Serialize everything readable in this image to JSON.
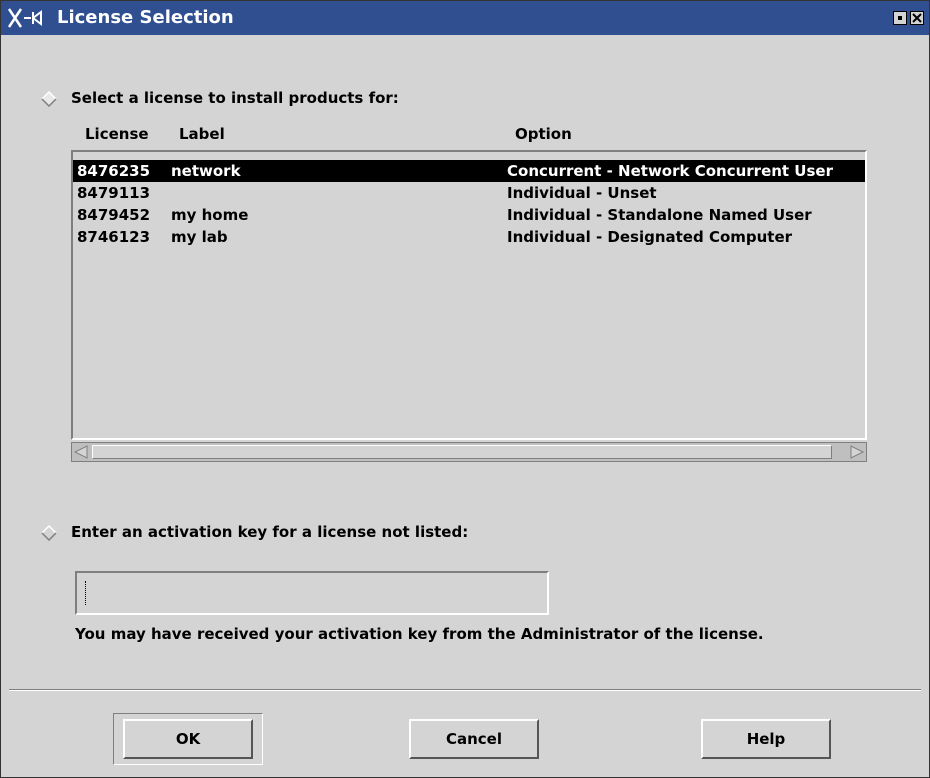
{
  "window": {
    "title": "License Selection"
  },
  "option_list": {
    "label": "Select a license to install products for:",
    "columns": {
      "license": "License",
      "label": "Label",
      "option": "Option"
    },
    "rows": [
      {
        "license": "8476235",
        "label": "network",
        "option": "Concurrent - Network Concurrent User"
      },
      {
        "license": "8479113",
        "label": "",
        "option": "Individual - Unset"
      },
      {
        "license": "8479452",
        "label": "my home",
        "option": "Individual - Standalone Named User"
      },
      {
        "license": "8746123",
        "label": "my lab",
        "option": "Individual - Designated Computer"
      }
    ]
  },
  "option_key": {
    "label": "Enter an activation key for a license not listed:",
    "value": "",
    "hint": "You may have received your activation key from the Administrator of the license."
  },
  "buttons": {
    "ok": "OK",
    "cancel": "Cancel",
    "help": "Help"
  },
  "colors": {
    "titlebar": "#2f4f91",
    "background": "#d4d4d4",
    "selection": "#000000"
  }
}
